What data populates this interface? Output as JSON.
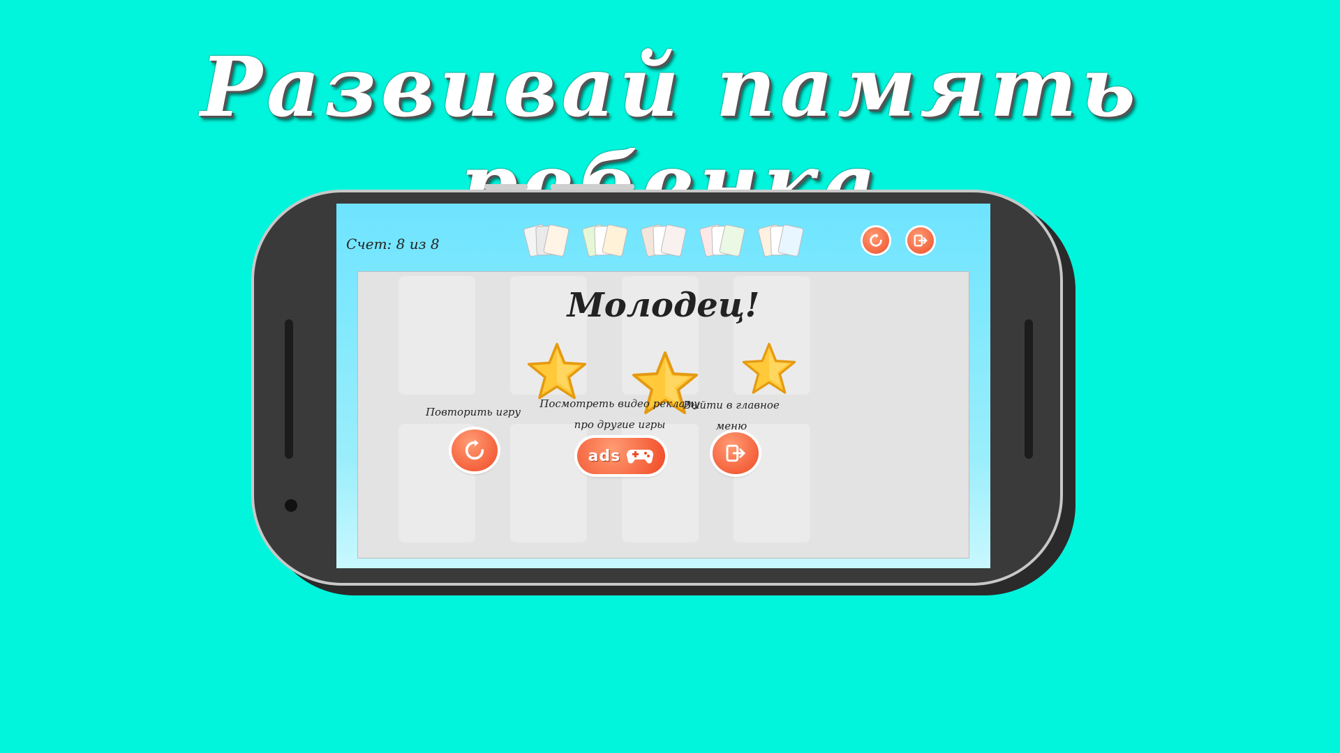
{
  "headline": "Развивай память ребенка",
  "colors": {
    "background": "#00f5dc",
    "accent": "#f04a25",
    "screen_top": "#6ee4ff"
  },
  "game": {
    "score": "Счет: 8 из 8",
    "packs": [
      {
        "icon": "bunny-cards-icon"
      },
      {
        "icon": "om-nom-cards-icon"
      },
      {
        "icon": "cars-cards-icon"
      },
      {
        "icon": "fruit-cards-icon"
      },
      {
        "icon": "fixies-cards-icon"
      }
    ],
    "top_buttons": {
      "restart_icon": "restart-icon",
      "exit_icon": "exit-icon"
    },
    "result": {
      "title": "Молодец!",
      "stars": 3,
      "stars_max": 3
    },
    "actions": {
      "replay_label": "Повторить игру",
      "ads_label_line1": "Посмотреть видео рекламу",
      "ads_label_line2": "про другие игры",
      "ads_button_text": "ads",
      "exit_label_line1": "Выйти в главное",
      "exit_label_line2": "меню"
    }
  }
}
